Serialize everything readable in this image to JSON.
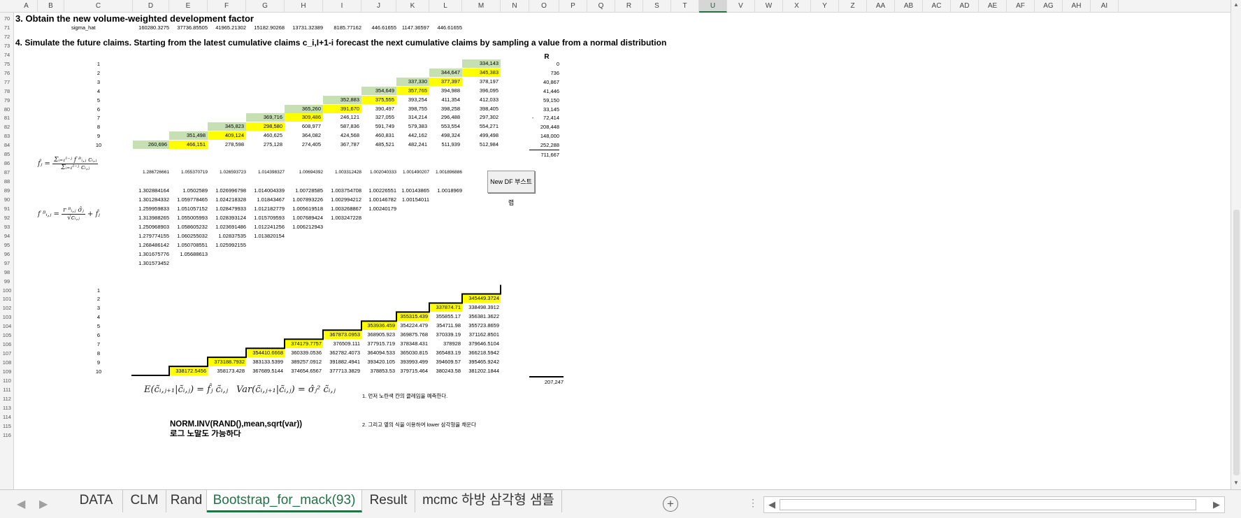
{
  "columns": [
    "A",
    "B",
    "C",
    "D",
    "E",
    "F",
    "G",
    "H",
    "I",
    "J",
    "K",
    "L",
    "M",
    "N",
    "O",
    "P",
    "Q",
    "R",
    "S",
    "T",
    "U",
    "V",
    "W",
    "X",
    "Y",
    "Z",
    "AA",
    "AB",
    "AC",
    "AD",
    "AE",
    "AF",
    "AG",
    "AH",
    "AI"
  ],
  "selected_column": "U",
  "rows": [
    "70",
    "71",
    "72",
    "73",
    "74",
    "75",
    "76",
    "77",
    "78",
    "79",
    "80",
    "81",
    "82",
    "83",
    "84",
    "85",
    "86",
    "87",
    "88",
    "89",
    "90",
    "91",
    "92",
    "93",
    "94",
    "95",
    "96",
    "97",
    "98",
    "99",
    "100",
    "101",
    "102",
    "103",
    "104",
    "105",
    "106",
    "107",
    "108",
    "109",
    "110",
    "111",
    "112",
    "113",
    "114",
    "115",
    "116"
  ],
  "section3": {
    "heading": "3. Obtain the new volume-weighted development factor",
    "sigma_label": "sigma_hat",
    "sigma_values": [
      "160280.3275",
      "37736.85505",
      "41965.21302",
      "15182.90268",
      "13731.32389",
      "8185.77162",
      "446.61655",
      "1147.36597",
      "446.61655"
    ]
  },
  "section4": {
    "heading": "4. Simulate the future claims. Starting from the latest cumulative claims c_i,I+1-i forecast the next cumulative claims by sampling a value from a normal distribution"
  },
  "triangle1": {
    "r_header": "R",
    "rows": [
      {
        "i": "1",
        "cells": [
          {
            "col": "M",
            "v": "334,143",
            "hl": "green"
          }
        ],
        "r": "0"
      },
      {
        "i": "2",
        "cells": [
          {
            "col": "L",
            "v": "344,647",
            "hl": "green"
          },
          {
            "col": "M",
            "v": "345,383",
            "hl": "yellow"
          }
        ],
        "r": "736"
      },
      {
        "i": "3",
        "cells": [
          {
            "col": "K",
            "v": "337,330",
            "hl": "green"
          },
          {
            "col": "L",
            "v": "377,397",
            "hl": "yellow"
          },
          {
            "col": "M",
            "v": "378,197",
            "hl": ""
          }
        ],
        "r": "40,867"
      },
      {
        "i": "4",
        "cells": [
          {
            "col": "J",
            "v": "354,649",
            "hl": "green"
          },
          {
            "col": "K",
            "v": "357,765",
            "hl": "yellow"
          },
          {
            "col": "L",
            "v": "394,988",
            "hl": ""
          },
          {
            "col": "M",
            "v": "396,095",
            "hl": ""
          }
        ],
        "r": "41,446"
      },
      {
        "i": "5",
        "cells": [
          {
            "col": "I",
            "v": "352,883",
            "hl": "green"
          },
          {
            "col": "J",
            "v": "375,555",
            "hl": "yellow"
          },
          {
            "col": "K",
            "v": "393,254",
            "hl": ""
          },
          {
            "col": "L",
            "v": "411,354",
            "hl": ""
          },
          {
            "col": "M",
            "v": "412,033",
            "hl": ""
          }
        ],
        "r": "59,150"
      },
      {
        "i": "6",
        "cells": [
          {
            "col": "H",
            "v": "365,260",
            "hl": "green"
          },
          {
            "col": "I",
            "v": "391,670",
            "hl": "yellow"
          },
          {
            "col": "J",
            "v": "390,497",
            "hl": ""
          },
          {
            "col": "K",
            "v": "398,755",
            "hl": ""
          },
          {
            "col": "L",
            "v": "398,258",
            "hl": ""
          },
          {
            "col": "M",
            "v": "398,405",
            "hl": ""
          }
        ],
        "r": "33,145"
      },
      {
        "i": "7",
        "cells": [
          {
            "col": "G",
            "v": "369,716",
            "hl": "green"
          },
          {
            "col": "H",
            "v": "309,486",
            "hl": "yellow"
          },
          {
            "col": "I",
            "v": "246,121",
            "hl": ""
          },
          {
            "col": "J",
            "v": "327,055",
            "hl": ""
          },
          {
            "col": "K",
            "v": "314,214",
            "hl": ""
          },
          {
            "col": "L",
            "v": "296,488",
            "hl": ""
          },
          {
            "col": "M",
            "v": "297,302",
            "hl": ""
          }
        ],
        "r": "72,414",
        "dash": "-"
      },
      {
        "i": "8",
        "cells": [
          {
            "col": "F",
            "v": "345,823",
            "hl": "green"
          },
          {
            "col": "G",
            "v": "298,580",
            "hl": "yellow"
          },
          {
            "col": "H",
            "v": "608,977",
            "hl": ""
          },
          {
            "col": "I",
            "v": "587,836",
            "hl": ""
          },
          {
            "col": "J",
            "v": "591,749",
            "hl": ""
          },
          {
            "col": "K",
            "v": "579,383",
            "hl": ""
          },
          {
            "col": "L",
            "v": "553,554",
            "hl": ""
          },
          {
            "col": "M",
            "v": "554,271",
            "hl": ""
          }
        ],
        "r": "208,448"
      },
      {
        "i": "9",
        "cells": [
          {
            "col": "E",
            "v": "351,498",
            "hl": "green"
          },
          {
            "col": "F",
            "v": "409,124",
            "hl": "yellow"
          },
          {
            "col": "G",
            "v": "460,625",
            "hl": ""
          },
          {
            "col": "H",
            "v": "364,082",
            "hl": ""
          },
          {
            "col": "I",
            "v": "424,568",
            "hl": ""
          },
          {
            "col": "J",
            "v": "460,831",
            "hl": ""
          },
          {
            "col": "K",
            "v": "442,162",
            "hl": ""
          },
          {
            "col": "L",
            "v": "498,324",
            "hl": ""
          },
          {
            "col": "M",
            "v": "499,498",
            "hl": ""
          }
        ],
        "r": "148,000"
      },
      {
        "i": "10",
        "cells": [
          {
            "col": "D",
            "v": "260,696",
            "hl": "green"
          },
          {
            "col": "E",
            "v": "466,151",
            "hl": "yellow"
          },
          {
            "col": "F",
            "v": "278,598",
            "hl": ""
          },
          {
            "col": "G",
            "v": "275,128",
            "hl": ""
          },
          {
            "col": "H",
            "v": "274,405",
            "hl": ""
          },
          {
            "col": "I",
            "v": "367,787",
            "hl": ""
          },
          {
            "col": "J",
            "v": "485,521",
            "hl": ""
          },
          {
            "col": "K",
            "v": "482,241",
            "hl": ""
          },
          {
            "col": "L",
            "v": "511,939",
            "hl": ""
          },
          {
            "col": "M",
            "v": "512,984",
            "hl": ""
          }
        ],
        "r": "252,288"
      }
    ],
    "r_total": "711,667"
  },
  "dev_factors": [
    "1.286726661",
    "1.055370719",
    "1.026593723",
    "1.014398327",
    "1.00694392",
    "1.003312428",
    "1.002040333",
    "1.001490207",
    "1.001896886"
  ],
  "new_df_button": "New DF 부스트랩",
  "bootstrap_factors": [
    [
      "1.302884164",
      "1.0502589",
      "1.026996798",
      "1.014004339",
      "1.00728585",
      "1.003754708",
      "1.00226551",
      "1.00143865",
      "1.0018969"
    ],
    [
      "1.301284332",
      "1.059778465",
      "1.024218328",
      "1.01843467",
      "1.007893226",
      "1.002994212",
      "1.00146782",
      "1.00154011"
    ],
    [
      "1.259959833",
      "1.051057152",
      "1.028479933",
      "1.012182779",
      "1.005619518",
      "1.003268867",
      "1.00240179"
    ],
    [
      "1.313988265",
      "1.055005993",
      "1.028393124",
      "1.015709593",
      "1.007689424",
      "1.003247228"
    ],
    [
      "1.250968903",
      "1.058605232",
      "1.023691486",
      "1.012241256",
      "1.006212943"
    ],
    [
      "1.279774155",
      "1.060255032",
      "1.02837535",
      "1.013820154"
    ],
    [
      "1.268486142",
      "1.050708551",
      "1.025992155"
    ],
    [
      "1.301675776",
      "1.05688613"
    ],
    [
      "1.301573452"
    ]
  ],
  "formula_f_hat": {
    "lhs": "f̂ⱼ =",
    "num": "Σᵢ₌₁ᴵ⁻ʲ f ᴮᵢ,ⱼ cᵢ,ⱼ",
    "den": "Σᵢ₌₁ᴵ⁻ʲ cᵢ,ⱼ"
  },
  "formula_f_b": {
    "lhs": "f ᴮᵢ,ⱼ =",
    "num": "r ᴮᵢ,ⱼ σ̂ⱼ",
    "den": "√cᵢ,ⱼ",
    "tail": "+ f̂ⱼ"
  },
  "triangle2": {
    "rows": [
      {
        "i": "1",
        "cells": []
      },
      {
        "i": "2",
        "cells": [
          {
            "col": "M",
            "v": "345449.3724",
            "hl": "yellow"
          }
        ]
      },
      {
        "i": "3",
        "cells": [
          {
            "col": "L",
            "v": "337874.71",
            "hl": "yellow"
          },
          {
            "col": "M",
            "v": "338498.3912",
            "hl": ""
          }
        ]
      },
      {
        "i": "4",
        "cells": [
          {
            "col": "K",
            "v": "355315.439",
            "hl": "yellow"
          },
          {
            "col": "L",
            "v": "355855.17",
            "hl": ""
          },
          {
            "col": "M",
            "v": "356381.3622",
            "hl": ""
          }
        ]
      },
      {
        "i": "5",
        "cells": [
          {
            "col": "J",
            "v": "353936.459",
            "hl": "yellow"
          },
          {
            "col": "K",
            "v": "354224.479",
            "hl": ""
          },
          {
            "col": "L",
            "v": "354711.98",
            "hl": ""
          },
          {
            "col": "M",
            "v": "355723.8659",
            "hl": ""
          }
        ]
      },
      {
        "i": "6",
        "cells": [
          {
            "col": "I",
            "v": "367873.0953",
            "hl": "yellow"
          },
          {
            "col": "J",
            "v": "368905.923",
            "hl": ""
          },
          {
            "col": "K",
            "v": "369875.768",
            "hl": ""
          },
          {
            "col": "L",
            "v": "370339.19",
            "hl": ""
          },
          {
            "col": "M",
            "v": "371162.8501",
            "hl": ""
          }
        ]
      },
      {
        "i": "7",
        "cells": [
          {
            "col": "H",
            "v": "374179.7757",
            "hl": "yellow"
          },
          {
            "col": "I",
            "v": "376509.111",
            "hl": ""
          },
          {
            "col": "J",
            "v": "377915.719",
            "hl": ""
          },
          {
            "col": "K",
            "v": "378348.431",
            "hl": ""
          },
          {
            "col": "L",
            "v": "378928",
            "hl": ""
          },
          {
            "col": "M",
            "v": "379646.5104",
            "hl": ""
          }
        ]
      },
      {
        "i": "8",
        "cells": [
          {
            "col": "G",
            "v": "354410.6668",
            "hl": "yellow"
          },
          {
            "col": "H",
            "v": "360339.0536",
            "hl": ""
          },
          {
            "col": "I",
            "v": "362782.4073",
            "hl": ""
          },
          {
            "col": "J",
            "v": "364094.533",
            "hl": ""
          },
          {
            "col": "K",
            "v": "365030.815",
            "hl": ""
          },
          {
            "col": "L",
            "v": "365483.19",
            "hl": ""
          },
          {
            "col": "M",
            "v": "366218.5942",
            "hl": ""
          }
        ]
      },
      {
        "i": "9",
        "cells": [
          {
            "col": "F",
            "v": "373188.7932",
            "hl": "yellow"
          },
          {
            "col": "G",
            "v": "383133.5399",
            "hl": ""
          },
          {
            "col": "H",
            "v": "389257.0912",
            "hl": ""
          },
          {
            "col": "I",
            "v": "391882.4941",
            "hl": ""
          },
          {
            "col": "J",
            "v": "393420.105",
            "hl": ""
          },
          {
            "col": "K",
            "v": "393993.499",
            "hl": ""
          },
          {
            "col": "L",
            "v": "394609.57",
            "hl": ""
          },
          {
            "col": "M",
            "v": "395465.9242",
            "hl": ""
          }
        ]
      },
      {
        "i": "10",
        "cells": [
          {
            "col": "E",
            "v": "338172.5456",
            "hl": "yellow"
          },
          {
            "col": "F",
            "v": "358173.428",
            "hl": ""
          },
          {
            "col": "G",
            "v": "367689.5144",
            "hl": ""
          },
          {
            "col": "H",
            "v": "374654.6567",
            "hl": ""
          },
          {
            "col": "I",
            "v": "377713.3829",
            "hl": ""
          },
          {
            "col": "J",
            "v": "378853.53",
            "hl": ""
          },
          {
            "col": "K",
            "v": "379715.464",
            "hl": ""
          },
          {
            "col": "L",
            "v": "380243.58",
            "hl": ""
          },
          {
            "col": "M",
            "v": "381202.1844",
            "hl": ""
          }
        ]
      }
    ],
    "total": "207,247"
  },
  "expectation_formula": "E(c̃ᵢ,ⱼ₊₁|c̃ᵢ,ⱼ) = f̂ⱼ c̃ᵢ,ⱼ",
  "variance_formula": "Var(c̃ᵢ,ⱼ₊₁|c̃ᵢ,ⱼ) = σ̂ⱼ² c̃ᵢ,ⱼ",
  "note1": "1. 먼저 노란색 칸의 클레임을 예측한다.",
  "note2": "2. 그리고 옆의 식을 이용하여 lower 삼각형을 채운다",
  "norm_inv": "NORM.INV(RAND(),mean,sqrt(var))",
  "cut_text": "로그 노말도 가능하다",
  "tabs": [
    "DATA",
    "CLM",
    "Rand",
    "Bootstrap_for_mack(93)",
    "Result",
    "mcmc 하방 삼각형 샘플"
  ],
  "active_tab": "Bootstrap_for_mack(93)",
  "colors": {
    "green": "#c6e0b4",
    "yellow": "#ffff00",
    "accent": "#217346"
  }
}
